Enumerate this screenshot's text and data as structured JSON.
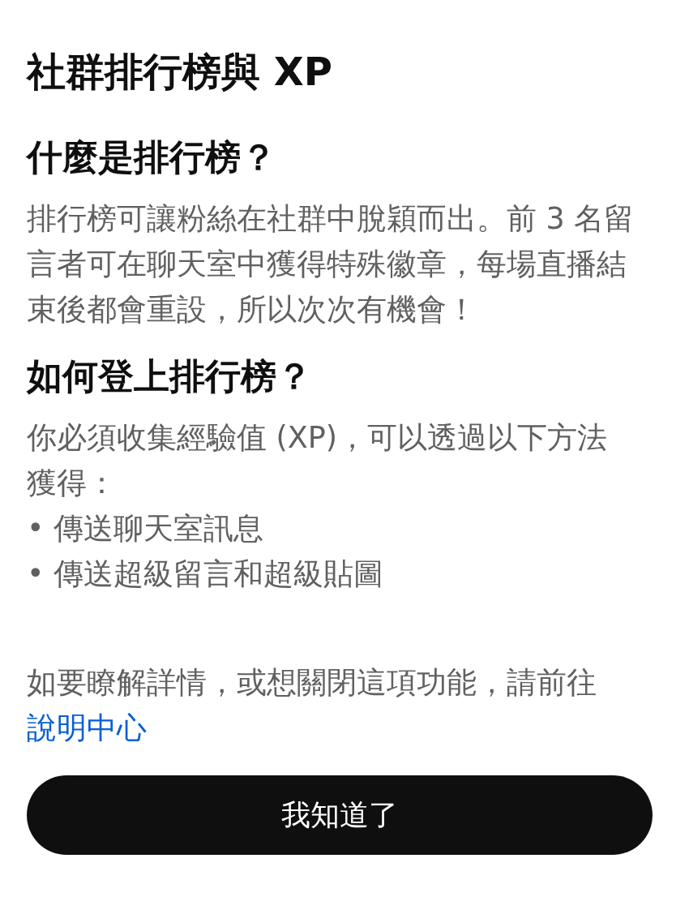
{
  "title": "社群排行榜與 XP",
  "sections": [
    {
      "heading": "什麼是排行榜？",
      "paragraph": "排行榜可讓粉絲在社群中脫穎而出。前 3 名留言者可在聊天室中獲得特殊徽章，每場直播結束後都會重設，所以次次有機會！"
    },
    {
      "heading": "如何登上排行榜？",
      "paragraph": "你必須收集經驗值 (XP)，可以透過以下方法獲得：",
      "bullets": [
        "• 傳送聊天室訊息",
        "• 傳送超級留言和超級貼圖"
      ]
    }
  ],
  "footer": {
    "text": "如要瞭解詳情，或想關閉這項功能，請前往",
    "link": "說明中心"
  },
  "button": "我知道了"
}
